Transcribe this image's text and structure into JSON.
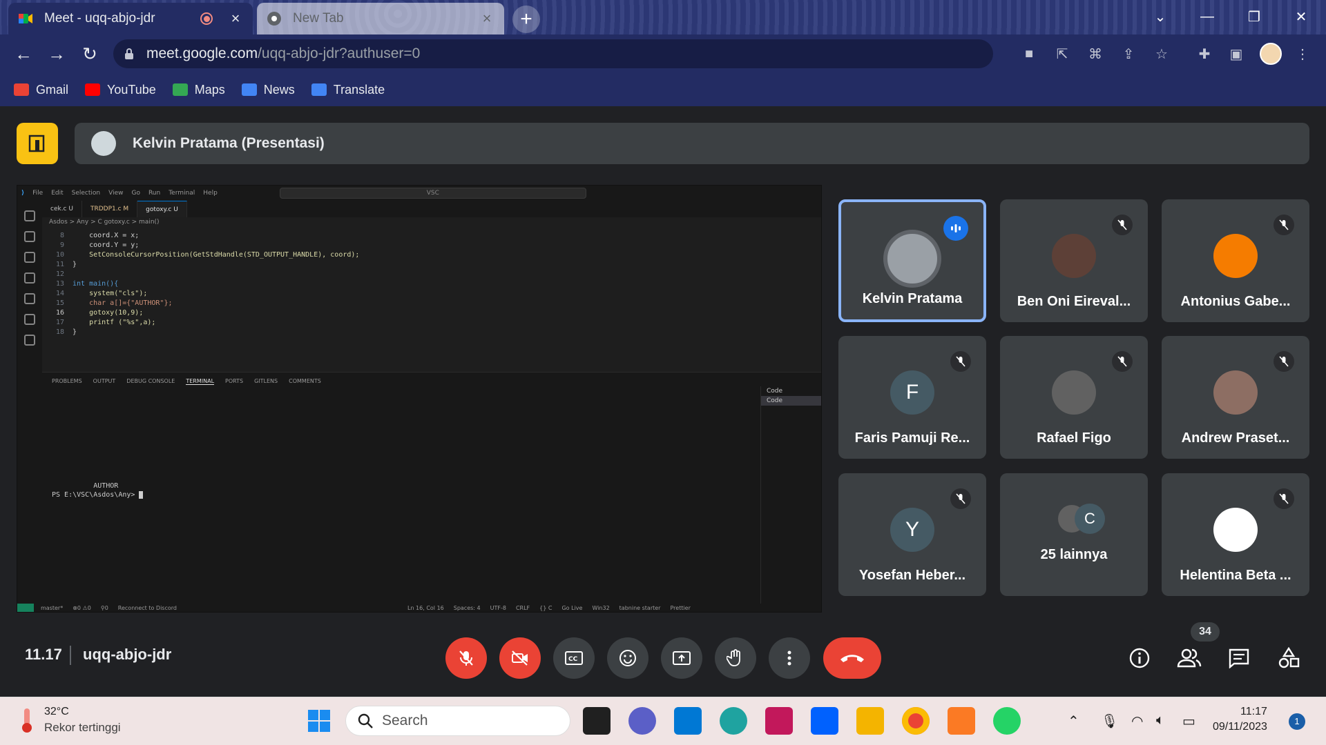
{
  "browser": {
    "tabs": [
      {
        "title": "Meet - uqq-abjo-jdr",
        "active": true
      },
      {
        "title": "New Tab",
        "active": false
      }
    ],
    "url_host": "meet.google.com",
    "url_path": "/uqq-abjo-jdr?authuser=0",
    "bookmarks": [
      {
        "label": "Gmail",
        "color": "#ea4335"
      },
      {
        "label": "YouTube",
        "color": "#ff0000"
      },
      {
        "label": "Maps",
        "color": "#34a853"
      },
      {
        "label": "News",
        "color": "#4285f4"
      },
      {
        "label": "Translate",
        "color": "#4285f4"
      }
    ]
  },
  "meet": {
    "presenter_title": "Kelvin Pratama (Presentasi)",
    "time": "11.17",
    "meeting_code": "uqq-abjo-jdr",
    "people_count": "34",
    "participants": [
      {
        "name": "Kelvin Pratama",
        "speaking": true,
        "avatar_color": "#9aa0a6"
      },
      {
        "name": "Ben Oni Eireval...",
        "muted": true,
        "avatar_color": "#5d4037"
      },
      {
        "name": "Antonius Gabe...",
        "muted": true,
        "avatar_color": "#f57c00"
      },
      {
        "name": "Faris Pamuji Re...",
        "muted": true,
        "initial": "F",
        "avatar_color": "#455a64"
      },
      {
        "name": "Rafael Figo",
        "muted": true,
        "avatar_color": "#616161"
      },
      {
        "name": "Andrew Praset...",
        "muted": true,
        "avatar_color": "#8d6e63"
      },
      {
        "name": "Yosefan Heber...",
        "muted": true,
        "initial": "Y",
        "avatar_color": "#455a64"
      },
      {
        "name": "25 lainnya",
        "initial": "C",
        "avatar_color": "#455a64"
      },
      {
        "name": "Helentina Beta ...",
        "muted": true,
        "avatar_color": "#ffffff"
      }
    ]
  },
  "vscode": {
    "menu": [
      "File",
      "Edit",
      "Selection",
      "View",
      "Go",
      "Run",
      "Terminal",
      "Help"
    ],
    "search": "VSC",
    "tabs": [
      {
        "label": "cek.c  U",
        "active": false
      },
      {
        "label": "TRDDP1.c  M",
        "active": false
      },
      {
        "label": "gotoxy.c  U",
        "active": true
      }
    ],
    "breadcrumb": "Asdos > Any > C gotoxy.c > main()",
    "code": [
      {
        "ln": "8",
        "txt": "    coord.X = x;"
      },
      {
        "ln": "9",
        "txt": "    coord.Y = y;"
      },
      {
        "ln": "10",
        "txt": "    SetConsoleCursorPosition(GetStdHandle(STD_OUTPUT_HANDLE), coord);"
      },
      {
        "ln": "11",
        "txt": "}"
      },
      {
        "ln": "12",
        "txt": ""
      },
      {
        "ln": "13",
        "txt": "int main(){"
      },
      {
        "ln": "14",
        "txt": "    system(\"cls\");"
      },
      {
        "ln": "15",
        "txt": "    char a[]={\"AUTHOR\"};"
      },
      {
        "ln": "16",
        "txt": "    gotoxy(10,9);"
      },
      {
        "ln": "17",
        "txt": "    printf (\"%s\",a);"
      },
      {
        "ln": "18",
        "txt": "}"
      }
    ],
    "panel_tabs": [
      "PROBLEMS",
      "OUTPUT",
      "DEBUG CONSOLE",
      "TERMINAL",
      "PORTS",
      "GITLENS",
      "COMMENTS"
    ],
    "terminal_output": "          AUTHOR",
    "terminal_prompt": "PS E:\\VSC\\Asdos\\Any> ",
    "terminal_list": [
      "Code",
      "Code"
    ],
    "status": [
      "master*",
      "⊗0 ⚠0",
      "⚲0",
      "Reconnect to Discord",
      "Ln 16, Col 16",
      "Spaces: 4",
      "UTF-8",
      "CRLF",
      "{} C",
      "Go Live",
      "Win32",
      "tabnine starter",
      "Prettier"
    ]
  },
  "taskbar": {
    "temperature": "32°C",
    "weather_desc": "Rekor tertinggi",
    "search_placeholder": "Search",
    "time": "11:17",
    "date": "09/11/2023",
    "notifications": "1"
  }
}
